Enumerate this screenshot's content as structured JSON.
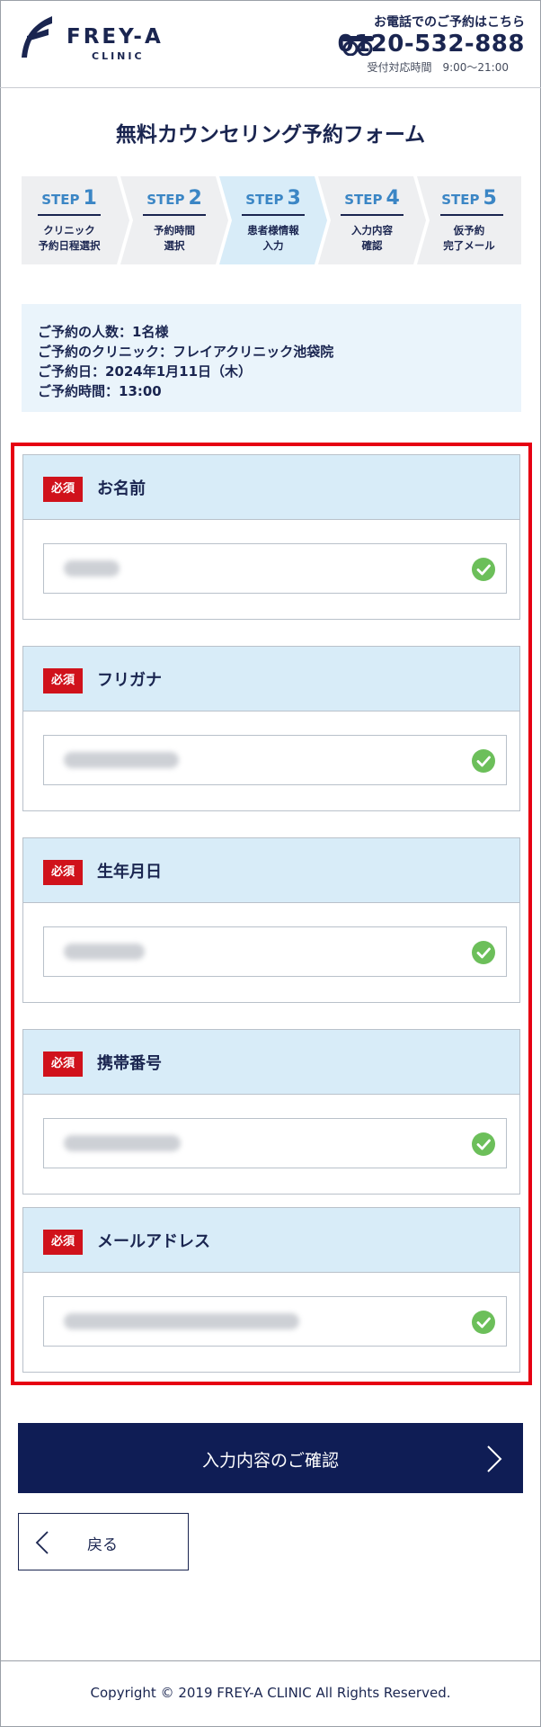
{
  "header": {
    "logo_title": "FREY-A",
    "logo_subtitle": "CLINIC",
    "tel_label": "お電話でのご予約はこちら",
    "tel_number": "0120-532-888",
    "tel_hours": "受付対応時間　9:00～21:00",
    "tel_icon": "free-dial-icon",
    "logo_icon": "frey-a-logo-mark"
  },
  "page_title": "無料カウンセリング予約フォーム",
  "steps": [
    {
      "label": "STEP",
      "num": "1",
      "text": "クリニック\n予約日程選択",
      "active": false
    },
    {
      "label": "STEP",
      "num": "2",
      "text": "予約時間\n選択",
      "active": false
    },
    {
      "label": "STEP",
      "num": "3",
      "text": "患者様情報\n入力",
      "active": true
    },
    {
      "label": "STEP",
      "num": "4",
      "text": "入力内容\n確認",
      "active": false
    },
    {
      "label": "STEP",
      "num": "5",
      "text": "仮予約\n完了メール",
      "active": false
    }
  ],
  "reservation": {
    "people": "ご予約の人数：1名様",
    "clinic": "ご予約のクリニック：フレイアクリニック池袋院",
    "date": "ご予約日：2024年1月11日（木）",
    "time": "ご予約時間：13:00"
  },
  "form": {
    "required_badge": "必須",
    "fields": [
      {
        "label": "お名前",
        "value_hidden": true
      },
      {
        "label": "フリガナ",
        "value_hidden": true
      },
      {
        "label": "生年月日",
        "value_hidden": true
      },
      {
        "label": "携帯番号",
        "value_hidden": true
      },
      {
        "label": "メールアドレス",
        "value_hidden": true
      }
    ]
  },
  "buttons": {
    "confirm": "入力内容のご確認",
    "back": "戻る"
  },
  "footer": {
    "copyright": "Copyright © 2019 FREY-A CLINIC All Rights Reserved."
  },
  "colors": {
    "navy": "#0f1d55",
    "step_blue": "#3b86c5",
    "step_active_bg": "#d8ecf8",
    "required_red": "#d0121b",
    "highlight_red": "#e60012",
    "check_green": "#6cbf5a"
  }
}
